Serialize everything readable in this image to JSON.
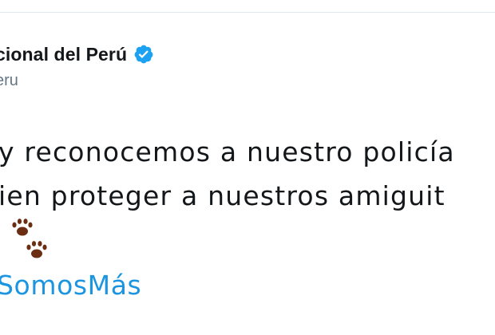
{
  "tweet": {
    "author": {
      "display_name": "cional del Perú",
      "handle": "eru",
      "verified_icon": "verified-badge-icon"
    },
    "text_lines": [
      "y reconocemos a nuestro policía",
      "ien proteger a nuestros amiguit"
    ],
    "emoji": "paw-prints-icon",
    "hashtag": "SomosMás"
  },
  "colors": {
    "text": "#14171a",
    "muted": "#657786",
    "link": "#1b95e0",
    "verified": "#1da1f2",
    "paw": "#6b2e12"
  }
}
